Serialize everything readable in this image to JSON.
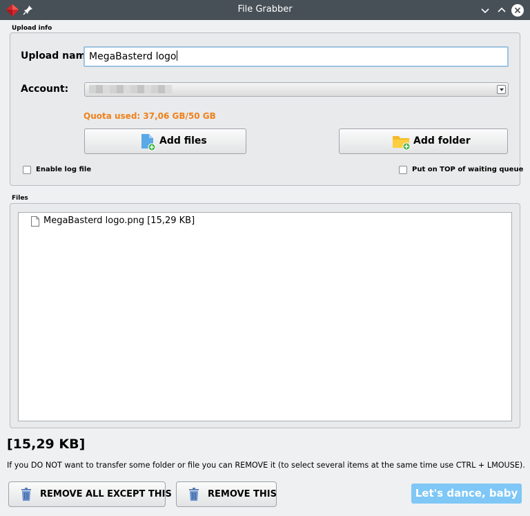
{
  "window": {
    "title": "File Grabber",
    "icons": {
      "app": "ruby-gem-icon",
      "pin": "pin-icon",
      "minimize": "chevron-down-icon",
      "maximize": "chevron-up-icon",
      "close": "close-circle-icon"
    }
  },
  "upload_info": {
    "group_label": "Upload info",
    "upload_name_label": "Upload name:",
    "upload_name_value": "MegaBasterd logo",
    "account_label": "Account:",
    "account_value": "",
    "quota": "Quota used: 37,06 GB/50 GB",
    "add_files_label": "Add files",
    "add_folder_label": "Add folder",
    "enable_log_label": "Enable log file",
    "enable_log_checked": false,
    "put_on_top_label": "Put on TOP of waiting queue",
    "put_on_top_checked": false
  },
  "files": {
    "group_label": "Files",
    "items": [
      {
        "label": "MegaBasterd logo.png [15,29 KB]"
      }
    ]
  },
  "footer": {
    "total_size": "[15,29 KB]",
    "hint": "If you DO NOT want to transfer some folder or file you can REMOVE it (to select several items at the same time use CTRL + LMOUSE).",
    "remove_all_except_label": "REMOVE ALL EXCEPT THIS",
    "remove_this_label": "REMOVE THIS",
    "dance_label": "Let's dance, baby"
  },
  "colors": {
    "titlebar": "#475057",
    "quota_text": "#f0801a",
    "dance_button": "#7ec7f6",
    "input_focus_border": "#9cc3e0"
  }
}
